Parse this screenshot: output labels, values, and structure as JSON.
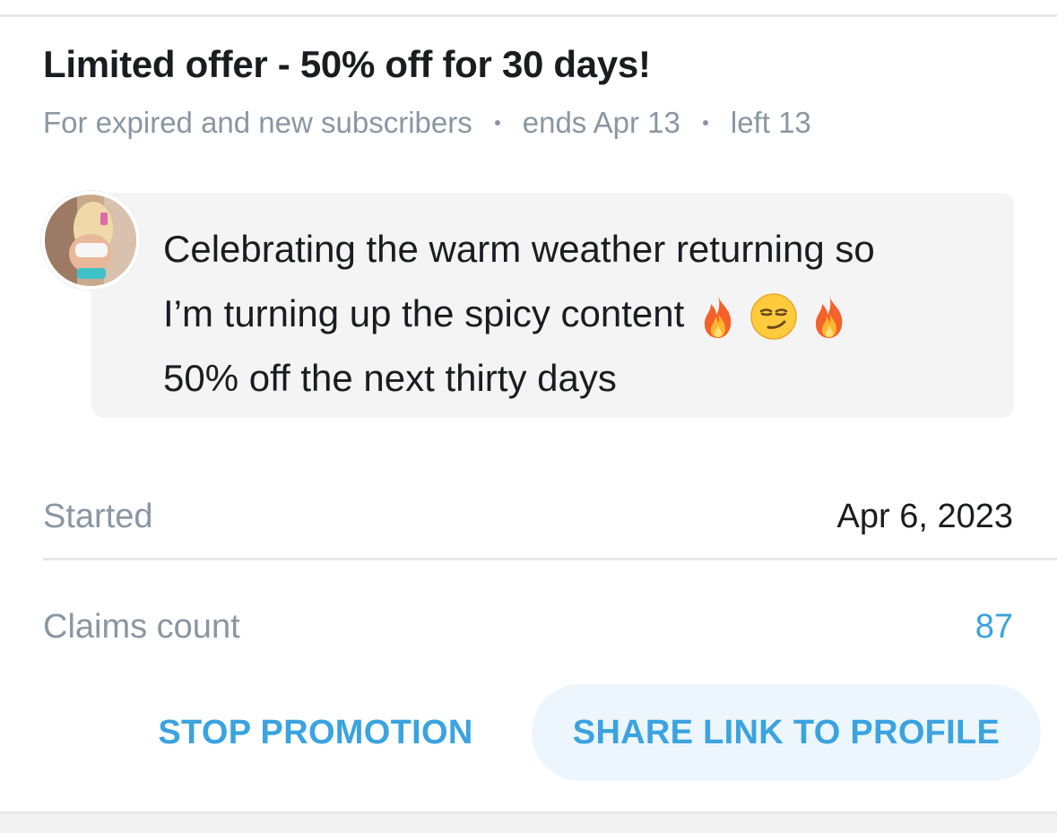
{
  "promotion": {
    "title": "Limited offer - 50% off for 30 days!",
    "audience": "For expired and new subscribers",
    "ends": "ends Apr 13",
    "left": "left 13"
  },
  "message": {
    "line1": "Celebrating the warm weather returning so",
    "line2": "I’m turning up the spicy content",
    "line3": "50% off the next thirty days",
    "emojis": [
      "fire-emoji",
      "smirk-emoji",
      "fire-emoji"
    ]
  },
  "details": {
    "started_label": "Started",
    "started_value": "Apr 6, 2023",
    "claims_label": "Claims count",
    "claims_value": "87"
  },
  "actions": {
    "stop_label": "STOP PROMOTION",
    "share_label": "SHARE LINK TO PROFILE"
  },
  "colors": {
    "accent": "#3aa3e0",
    "muted": "#8a96a3",
    "text": "#1b1c20",
    "bubble": "#f4f4f5",
    "share_button_bg": "#edf6fc"
  }
}
